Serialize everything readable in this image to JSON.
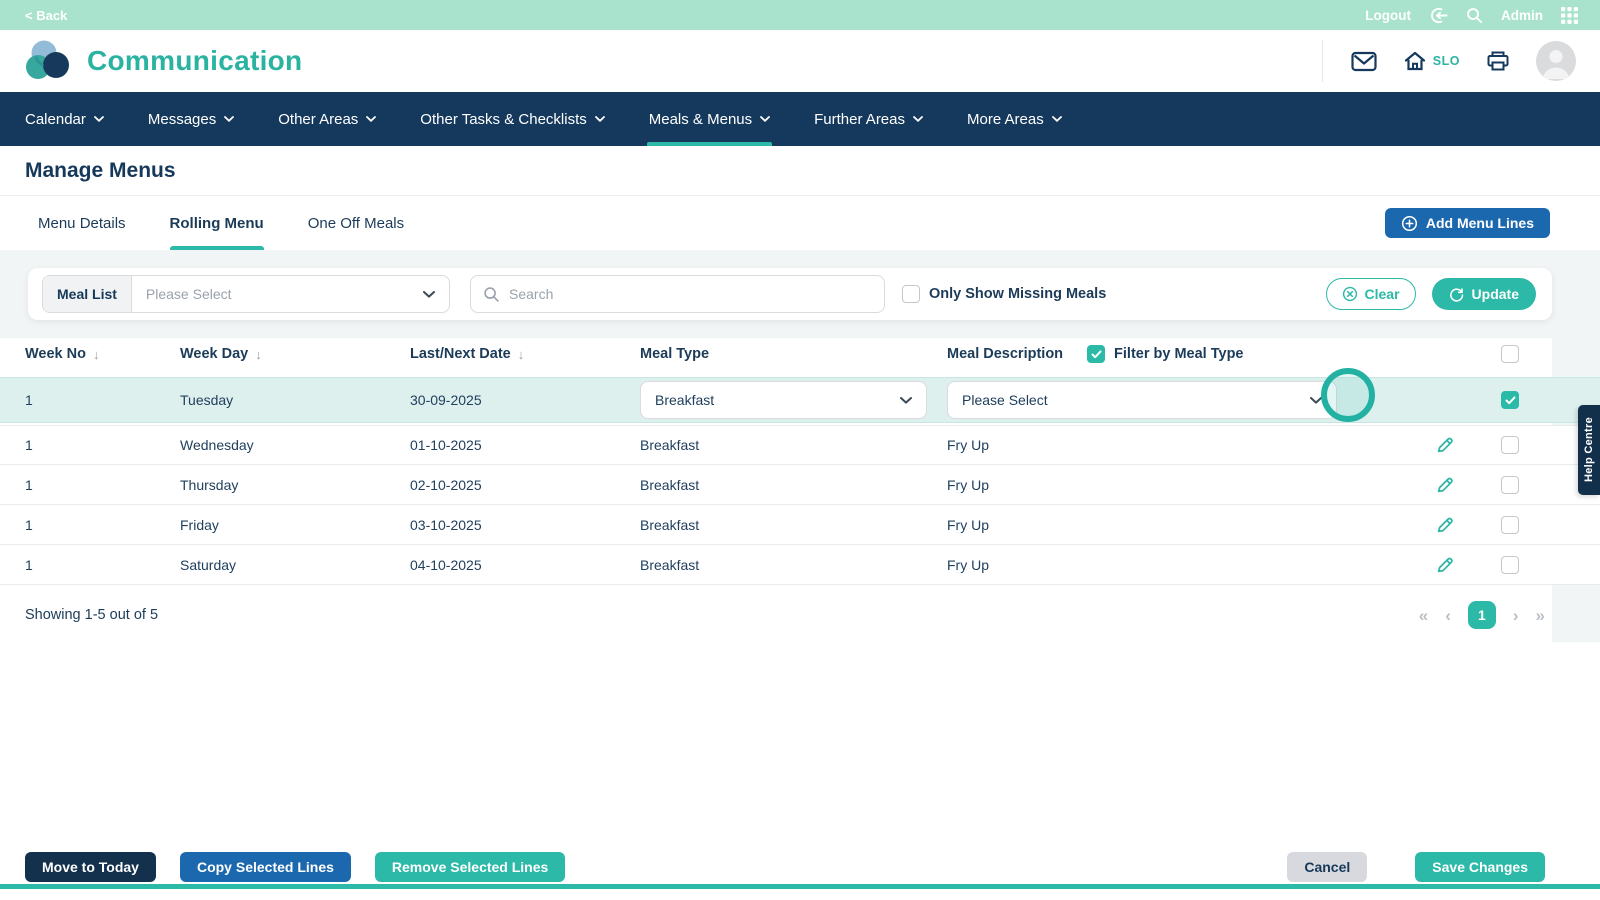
{
  "topbar": {
    "back_label": "< Back",
    "logout_label": "Logout",
    "admin_label": "Admin"
  },
  "header": {
    "app_title": "Communication",
    "slo_label": "SLO"
  },
  "nav": {
    "items": [
      "Calendar",
      "Messages",
      "Other Areas",
      "Other Tasks & Checklists",
      "Meals & Menus",
      "Further Areas",
      "More Areas"
    ],
    "active_item": "Meals & Menus"
  },
  "page": {
    "title": "Manage Menus"
  },
  "tabs": {
    "items": [
      "Menu Details",
      "Rolling Menu",
      "One Off Meals"
    ],
    "active_item": "Rolling Menu",
    "add_button_label": "Add Menu Lines"
  },
  "filters": {
    "meal_list_label": "Meal List",
    "meal_list_value": "Please Select",
    "search_placeholder": "Search",
    "only_show_missing_label": "Only Show Missing Meals",
    "clear_label": "Clear",
    "update_label": "Update"
  },
  "table": {
    "headers": {
      "week_no": "Week No",
      "week_day": "Week Day",
      "date": "Last/Next Date",
      "meal_type": "Meal Type",
      "meal_description": "Meal Description",
      "filter_by_meal_type": "Filter by Meal Type"
    },
    "rows": [
      {
        "week_no": "1",
        "week_day": "Tuesday",
        "date": "30-09-2025",
        "meal_type": "Breakfast",
        "meal_description": "Please Select",
        "selected": true
      },
      {
        "week_no": "1",
        "week_day": "Wednesday",
        "date": "01-10-2025",
        "meal_type": "Breakfast",
        "meal_description": "Fry Up",
        "selected": false
      },
      {
        "week_no": "1",
        "week_day": "Thursday",
        "date": "02-10-2025",
        "meal_type": "Breakfast",
        "meal_description": "Fry Up",
        "selected": false
      },
      {
        "week_no": "1",
        "week_day": "Friday",
        "date": "03-10-2025",
        "meal_type": "Breakfast",
        "meal_description": "Fry Up",
        "selected": false
      },
      {
        "week_no": "1",
        "week_day": "Saturday",
        "date": "04-10-2025",
        "meal_type": "Breakfast",
        "meal_description": "Fry Up",
        "selected": false
      }
    ]
  },
  "pagination": {
    "summary": "Showing 1-5 out of 5",
    "current_page": "1",
    "first": "«",
    "prev": "‹",
    "next": "›",
    "last": "»"
  },
  "footer": {
    "move_to_today": "Move to Today",
    "copy_selected_lines": "Copy Selected Lines",
    "remove_selected_lines": "Remove Selected Lines",
    "cancel": "Cancel",
    "save_changes": "Save Changes"
  },
  "help_centre": {
    "label": "Help Centre"
  },
  "icons": {
    "sort_desc": "↓"
  },
  "colors": {
    "accent_teal": "#2cb9a8",
    "brand_teal_text": "#2bb3a2",
    "navy": "#14395c",
    "blue_button": "#1c68ae",
    "dark_navy_button": "#13304d",
    "mint_topbar": "#a9e3cd",
    "row_highlight": "#ddf0ee",
    "cancel_gray": "#d8d9de"
  }
}
